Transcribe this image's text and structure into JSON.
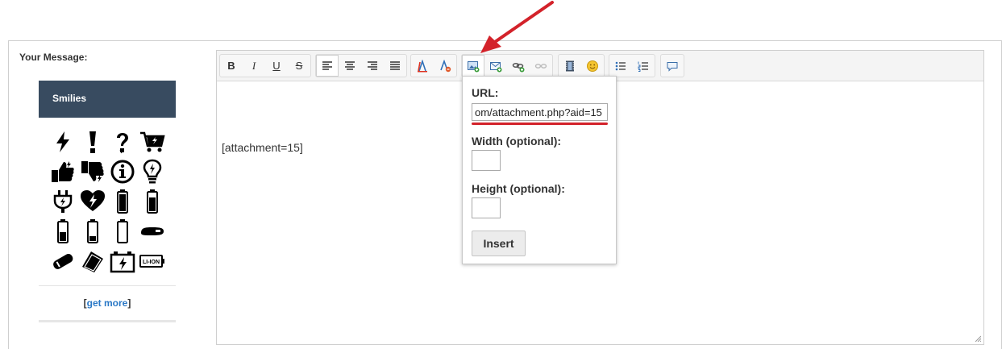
{
  "form": {
    "message_label": "Your Message:"
  },
  "smilies": {
    "title": "Smilies",
    "icons": [
      "lightning-icon",
      "exclamation-icon",
      "question-icon",
      "cart-icon",
      "thumbs-up-icon",
      "thumbs-down-icon",
      "info-icon",
      "lightbulb-icon",
      "plug-icon",
      "broken-heart-icon",
      "battery-full-icon",
      "battery-high-icon",
      "battery-half-icon",
      "battery-low-icon",
      "battery-empty-icon",
      "battery-flat-icon",
      "battery-tilted-icon",
      "battery-pack-icon",
      "car-battery-icon",
      "li-ion-battery-icon"
    ],
    "li_ion_text": "LI-ION",
    "get_more": {
      "open": "[",
      "link": "get more",
      "close": "]"
    }
  },
  "toolbar": {
    "bold": "B",
    "italic": "I",
    "underline": "U",
    "strike": "S"
  },
  "editor": {
    "content": "[attachment=15]"
  },
  "popup": {
    "url_label": "URL:",
    "url_value": "om/attachment.php?aid=15",
    "width_label": "Width (optional):",
    "height_label": "Height (optional):",
    "insert_label": "Insert"
  },
  "colors": {
    "header_bg": "#384b60",
    "link": "#2a78c6",
    "annotation_red": "#d3222a"
  }
}
